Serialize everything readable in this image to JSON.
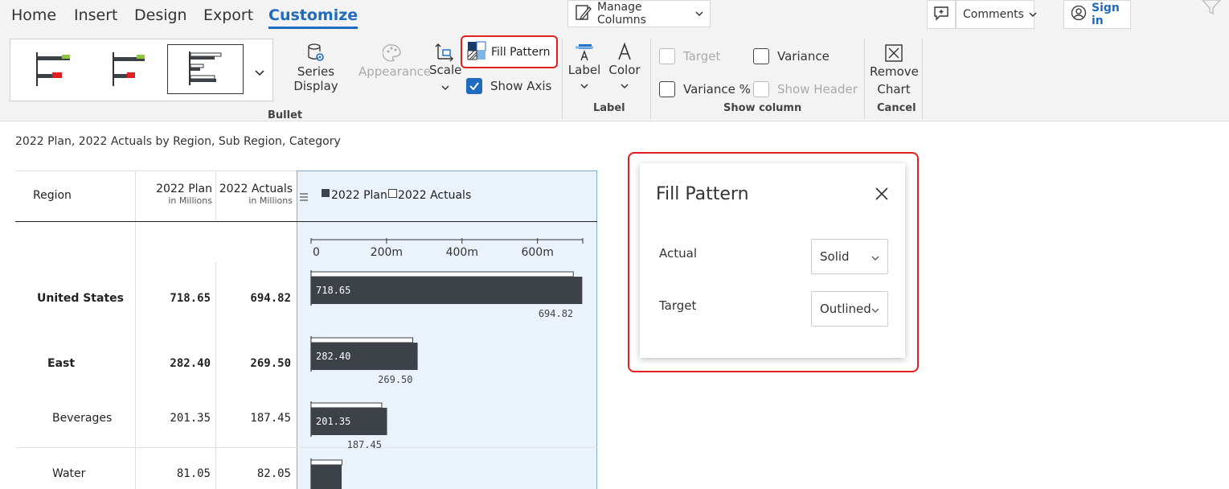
{
  "tabs": [
    "Home",
    "Insert",
    "Design",
    "Export",
    "Customize"
  ],
  "active_tab": "Customize",
  "toolbar_top": {
    "manage_columns": "Manage Columns",
    "comments": "Comments",
    "sign_in": "Sign in"
  },
  "ribbon": {
    "gallery_group_label": "Bullet",
    "series_display": "Series Display",
    "appearance": "Appearance",
    "scale": "Scale",
    "fill_pattern": "Fill Pattern",
    "show_axis": "Show Axis",
    "label_group": {
      "label": "Label",
      "color": "Color",
      "group_label": "Label"
    },
    "show_column_group": {
      "target": "Target",
      "variance": "Variance",
      "variance_pct": "Variance %",
      "show_header": "Show Header",
      "group_label": "Show column"
    },
    "remove_chart_line1": "Remove",
    "remove_chart_line2": "Chart",
    "cancel_group_label": "Cancel"
  },
  "table": {
    "subtitle": "2022 Plan, 2022 Actuals by Region, Sub Region, Category",
    "headers": {
      "region": "Region",
      "plan": "2022 Plan",
      "plan_unit": "in Millions",
      "actuals": "2022 Actuals",
      "actuals_unit": "in Millions",
      "legend_plan": "2022 Plan",
      "legend_actuals": "2022 Actuals"
    },
    "axis_ticks": [
      "0",
      "200m",
      "400m",
      "600m"
    ],
    "rows": [
      {
        "region": "United States",
        "plan": "718.65",
        "actuals": "694.82",
        "plan_label": "718.65",
        "actual_label": "694.82"
      },
      {
        "region": "East",
        "plan": "282.40",
        "actuals": "269.50",
        "plan_label": "282.40",
        "actual_label": "269.50"
      },
      {
        "region": "Beverages",
        "plan": "201.35",
        "actuals": "187.45",
        "plan_label": "201.35",
        "actual_label": "187.45"
      },
      {
        "region": "Water",
        "plan": "81.05",
        "actuals": "82.05"
      }
    ]
  },
  "chart_data": {
    "type": "bar",
    "categories": [
      "United States",
      "East",
      "Beverages",
      "Water"
    ],
    "series": [
      {
        "name": "2022 Plan",
        "values": [
          718.65,
          282.4,
          201.35,
          81.05
        ]
      },
      {
        "name": "2022 Actuals",
        "values": [
          694.82,
          269.5,
          187.45,
          82.05
        ]
      }
    ],
    "xlim": [
      0,
      720
    ],
    "ticks": [
      "0",
      "200m",
      "400m",
      "600m"
    ],
    "legend": "top-left"
  },
  "fill_pattern_panel": {
    "title": "Fill Pattern",
    "actual_label": "Actual",
    "actual_value": "Solid",
    "target_label": "Target",
    "target_value": "Outlined"
  },
  "colors": {
    "accent": "#1f6bbf",
    "bar": "#3d4148",
    "highlight": "#e02020",
    "chart_bg": "#eaf2fb"
  }
}
